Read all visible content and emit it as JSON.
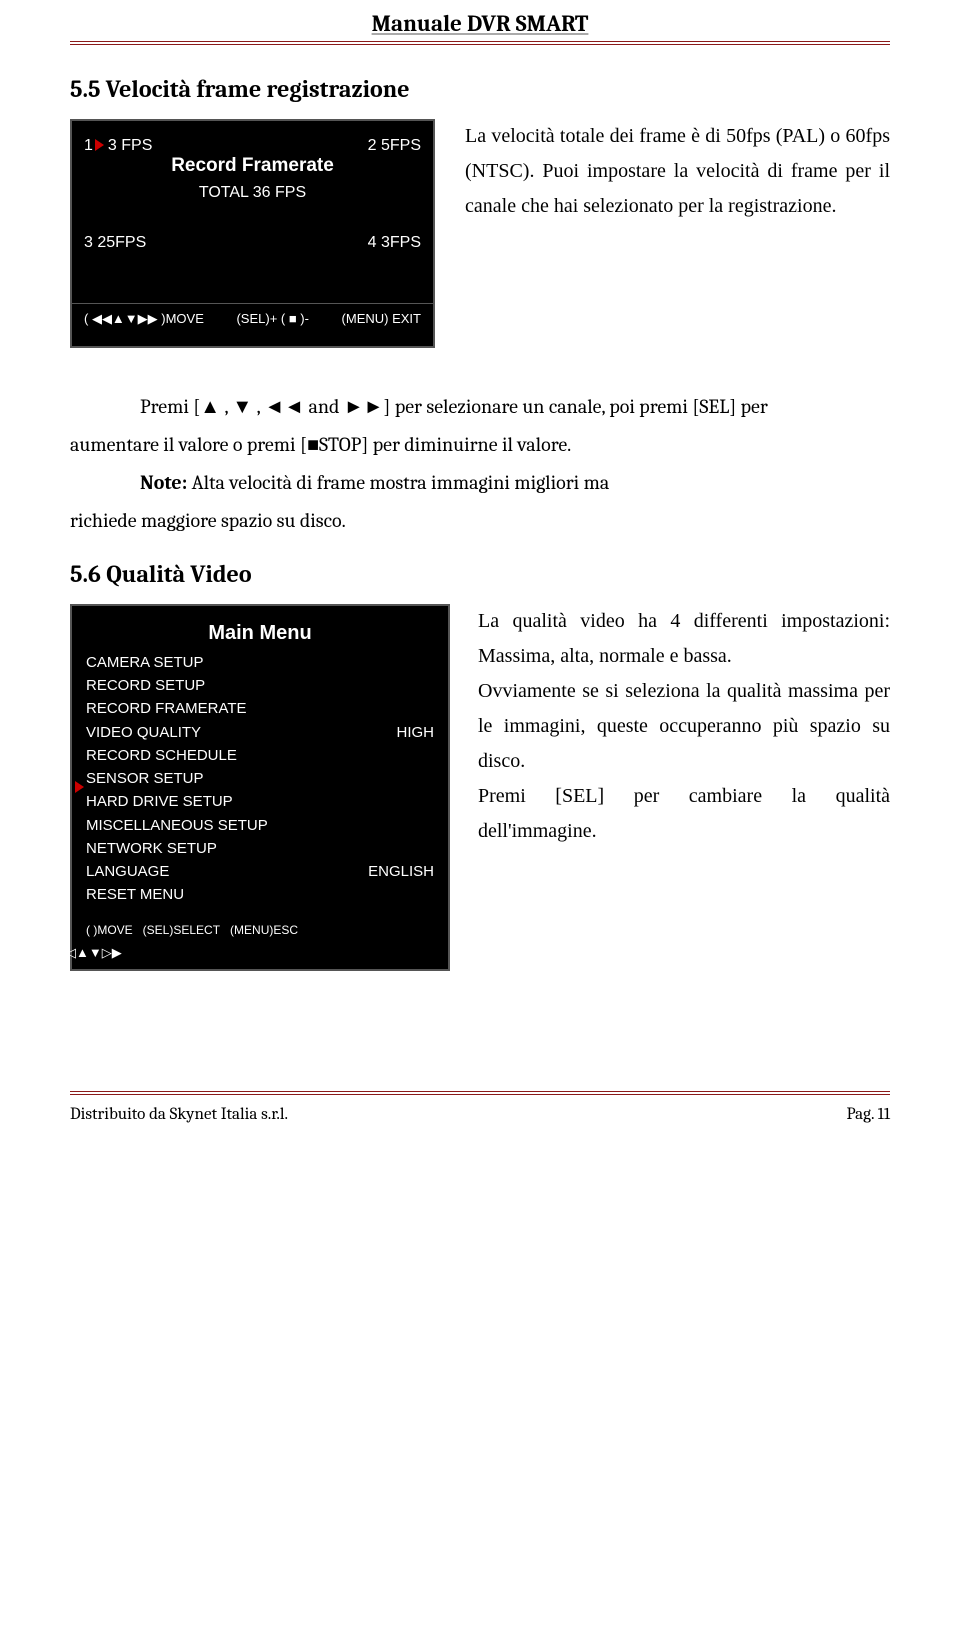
{
  "doc_header": "Manuale DVR SMART",
  "sec55": {
    "heading": "5.5 Velocità frame registrazione",
    "osd": {
      "ch1": "1",
      "ch1v": "3 FPS",
      "ch2": "2   5FPS",
      "title": "Record Framerate",
      "total": "TOTAL   36 FPS",
      "ch3": "3   25FPS",
      "ch4": "4   3FPS",
      "hint_move": "(  ◀◀▲▼▶▶ )MOVE",
      "hint_sel": "(SEL)+ ( ■ )-",
      "hint_exit": "(MENU) EXIT"
    },
    "para1": "La velocità totale dei frame è di 50fps (PAL) o 60fps (NTSC). Puoi impostare la velocità di frame per il canale che hai selezionato per la registrazione.",
    "para2_pre": "Premi [▲ , ▼ , ◄◄ and ►►] per selezionare un canale, poi premi [SEL] per",
    "para2_post": "aumentare il valore o premi [■STOP] per diminuirne il valore.",
    "note_label": "Note:",
    "note_text": " Alta velocità di frame mostra immagini migliori ma",
    "note_cont": "richiede maggiore spazio su disco."
  },
  "sec56": {
    "heading": "5.6 Qualità Video",
    "menu_title": "Main Menu",
    "items": [
      {
        "l": "CAMERA   SETUP",
        "r": ""
      },
      {
        "l": "RECORD SETUP",
        "r": ""
      },
      {
        "l": "RECORD FRAMERATE",
        "r": ""
      },
      {
        "l": "VIDEO QUALITY",
        "r": "HIGH"
      },
      {
        "l": "RECORD SCHEDULE",
        "r": ""
      },
      {
        "l": "SENSOR SETUP",
        "r": ""
      },
      {
        "l": "HARD DRIVE SETUP",
        "r": ""
      },
      {
        "l": "MISCELLANEOUS SETUP",
        "r": ""
      },
      {
        "l": "NETWORK SETUP",
        "r": ""
      },
      {
        "l": "LANGUAGE",
        "r": "ENGLISH"
      },
      {
        "l": "RESET MENU",
        "r": ""
      }
    ],
    "hints": {
      "a": "(          )MOVE",
      "b": "(SEL)SELECT",
      "c": "(MENU)ESC"
    },
    "chev": "◀◁▲▼▷▶",
    "p1": "La qualità video ha 4 differenti impostazioni: Massima, alta, normale e bassa.",
    "p2": "Ovviamente se si seleziona la qualità massima per le immagini, queste occuperanno più spazio su disco.",
    "p3": "Premi [SEL] per cambiare la qualità dell'immagine."
  },
  "footer": {
    "left": "Distribuito da Skynet Italia s.r.l.",
    "right": "Pag. 11"
  }
}
